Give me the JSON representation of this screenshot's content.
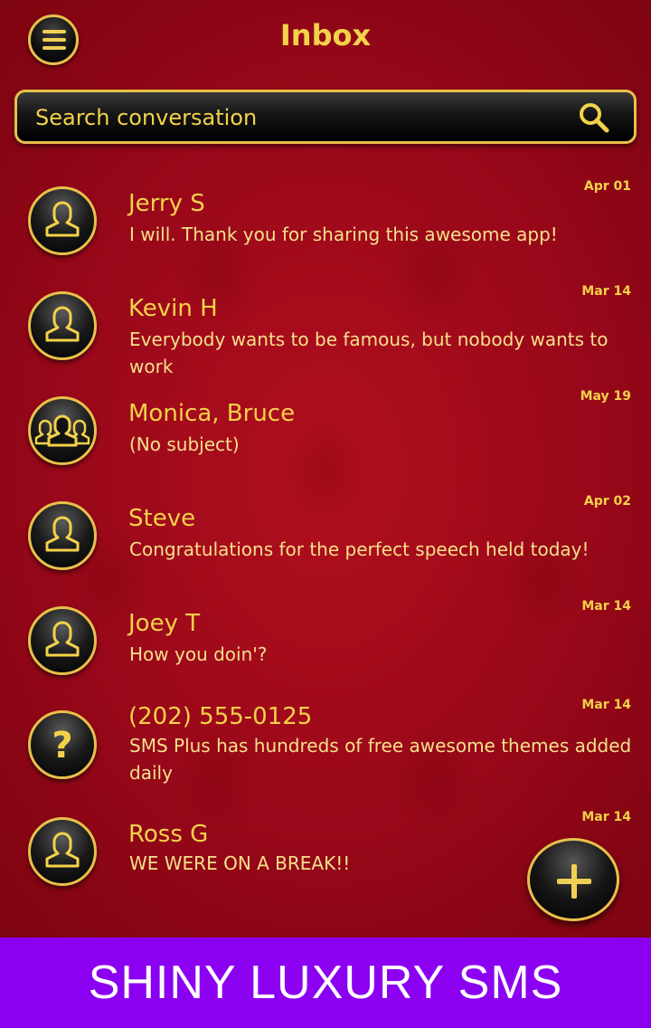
{
  "header": {
    "title": "Inbox"
  },
  "search": {
    "placeholder": "Search conversation"
  },
  "conversations": [
    {
      "name": "Jerry S",
      "snippet": "I will. Thank you for sharing this awesome app!",
      "date": "Apr 01",
      "avatar": "person-icon"
    },
    {
      "name": "Kevin H",
      "snippet": "Everybody wants to be famous, but nobody wants to work",
      "date": "Mar 14",
      "avatar": "person-icon"
    },
    {
      "name": "Monica, Bruce",
      "snippet": "(No subject)",
      "date": "May 19",
      "avatar": "group-icon"
    },
    {
      "name": "Steve",
      "snippet": "Congratulations for the perfect speech held today!",
      "date": "Apr 02",
      "avatar": "person-icon"
    },
    {
      "name": "Joey T",
      "snippet": "How you doin'?",
      "date": "Mar 14",
      "avatar": "person-icon"
    },
    {
      "name": "(202) 555-0125",
      "snippet": "SMS Plus has hundreds of free awesome themes added daily",
      "date": "Mar 14",
      "avatar": "unknown-contact-icon"
    },
    {
      "name": "Ross G",
      "snippet": "WE WERE ON A BREAK!!",
      "date": "Mar 14",
      "avatar": "person-icon"
    }
  ],
  "banner": {
    "text": "SHINY LUXURY SMS"
  },
  "colors": {
    "accent": "#f3d24a",
    "background": "#a10a18",
    "banner": "#8b00f0"
  }
}
